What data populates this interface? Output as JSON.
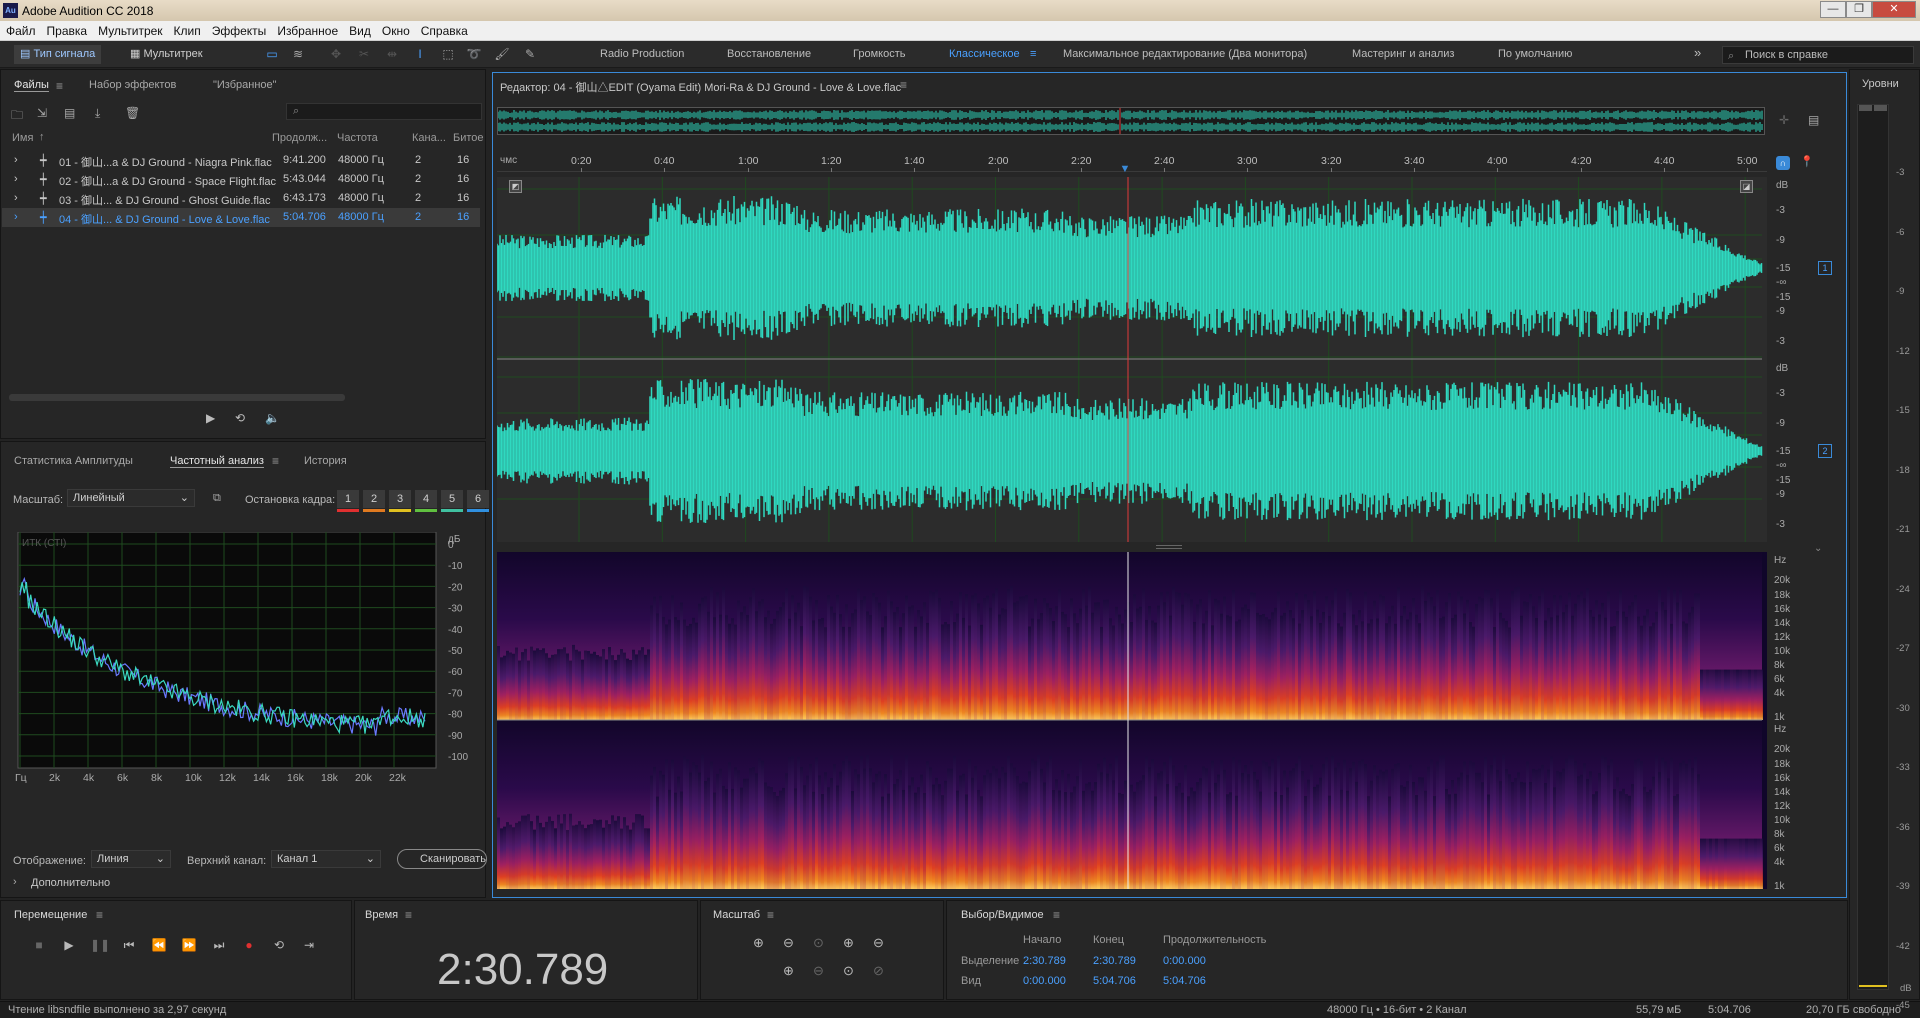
{
  "window": {
    "title": "Adobe Audition CC 2018",
    "app_icon": "Au",
    "min": "—",
    "max": "❐",
    "close": "✕"
  },
  "menu": [
    "Файл",
    "Правка",
    "Мультитрек",
    "Клип",
    "Эффекты",
    "Избранное",
    "Вид",
    "Окно",
    "Справка"
  ],
  "toolbar": {
    "waveform_view": "Тип сигнала",
    "multitrack_view": "Мультитрек",
    "workspaces": [
      "Radio Production",
      "Восстановление",
      "Громкость",
      "Классическое",
      "Максимальное редактирование (Два монитора)",
      "Мастеринг и анализ",
      "По умолчанию"
    ],
    "active_workspace": "Классическое",
    "more": "»",
    "search_placeholder": "Поиск в справке"
  },
  "files_panel": {
    "tabs": [
      "Файлы",
      "Набор эффектов",
      "\"Избранное\""
    ],
    "search_placeholder": "",
    "columns": [
      "Имя",
      "Продолж...",
      "Частота",
      "Кана...",
      "Битое"
    ],
    "rows": [
      {
        "name": "01 - 御山...a & DJ Ground - Niagra Pink.flac",
        "duration": "9:41.200",
        "rate": "48000 Гц",
        "channels": "2",
        "bits": "16"
      },
      {
        "name": "02 - 御山...a & DJ Ground - Space Flight.flac",
        "duration": "5:43.044",
        "rate": "48000 Гц",
        "channels": "2",
        "bits": "16"
      },
      {
        "name": "03 - 御山... & DJ Ground - Ghost Guide.flac",
        "duration": "6:43.173",
        "rate": "48000 Гц",
        "channels": "2",
        "bits": "16"
      },
      {
        "name": "04 - 御山... & DJ Ground - Love & Love.flac",
        "duration": "5:04.706",
        "rate": "48000 Гц",
        "channels": "2",
        "bits": "16"
      }
    ],
    "selected_row": 3
  },
  "analysis_panel": {
    "tabs": [
      "Статистика Амплитуды",
      "Частотный анализ",
      "История"
    ],
    "scale_label": "Масштаб:",
    "scale_value": "Линейный",
    "freeze_label": "Остановка кадра:",
    "freeze_frames": [
      "1",
      "2",
      "3",
      "4",
      "5",
      "6"
    ],
    "freeze_colors": [
      "#e03030",
      "#e07a20",
      "#e0c020",
      "#60c040",
      "#40c0a0",
      "#3090e0"
    ],
    "plot_label": "ИТК (СТI)",
    "db_unit": "дБ",
    "db_ticks": [
      "0",
      "-10",
      "-20",
      "-30",
      "-40",
      "-50",
      "-60",
      "-70",
      "-80",
      "-90",
      "-100"
    ],
    "x_ticks": [
      "Гц",
      "2k",
      "4k",
      "6k",
      "8k",
      "10k",
      "12k",
      "14k",
      "16k",
      "18k",
      "20k",
      "22k"
    ],
    "display_label": "Отображение:",
    "display_value": "Линия",
    "top_channel_label": "Верхний канал:",
    "top_channel_value": "Канал 1",
    "scan_button": "Сканировать",
    "advanced": "Дополнительно"
  },
  "editor": {
    "title": "Редактор: 04 - 御山△EDIT (Oyama Edit) Mori-Ra & DJ Ground - Love & Love.flac",
    "ruler_unit": "чмс",
    "ruler_ticks": [
      "0:20",
      "0:40",
      "1:00",
      "1:20",
      "1:40",
      "2:00",
      "2:20",
      "2:40",
      "3:00",
      "3:20",
      "3:40",
      "4:00",
      "4:20",
      "4:40",
      "5:00"
    ],
    "db_scale": [
      "dB",
      "-3",
      "-9",
      "-15",
      "-∞",
      "-15",
      "-9",
      "-3"
    ],
    "hz_scale": [
      "Hz",
      "20k",
      "18k",
      "16k",
      "14k",
      "12k",
      "10k",
      "8k",
      "6k",
      "4k",
      "1k"
    ],
    "channels": [
      "1",
      "2"
    ],
    "waveform_color": "#2fd9c0",
    "playhead_color": "#e03a3a",
    "playhead_time": "2:30.789",
    "duration": "5:04.706"
  },
  "meter": {
    "title": "Уровни",
    "ticks": [
      "-3",
      "-6",
      "-9",
      "-12",
      "-15",
      "-18",
      "-21",
      "-24",
      "-27",
      "-30",
      "-33",
      "-36",
      "-39",
      "-42",
      "-45"
    ],
    "unit": "dB"
  },
  "transport": {
    "title": "Перемещение"
  },
  "time_panel": {
    "title": "Время",
    "value": "2:30.789"
  },
  "zoom_panel": {
    "title": "Масштаб"
  },
  "selection_panel": {
    "title": "Выбор/Видимое",
    "headers": [
      "Начало",
      "Конец",
      "Продолжительность"
    ],
    "rows": [
      {
        "label": "Выделение",
        "start": "2:30.789",
        "end": "2:30.789",
        "duration": "0:00.000"
      },
      {
        "label": "Вид",
        "start": "0:00.000",
        "end": "5:04.706",
        "duration": "5:04.706"
      }
    ]
  },
  "status": {
    "message": "Чтение libsndfile выполнено за 2,97 секунд",
    "format": "48000 Гц • 16-бит • 2 Канал",
    "size": "55,79 мБ",
    "length": "5:04.706",
    "free": "20,70 ГБ свободно"
  }
}
